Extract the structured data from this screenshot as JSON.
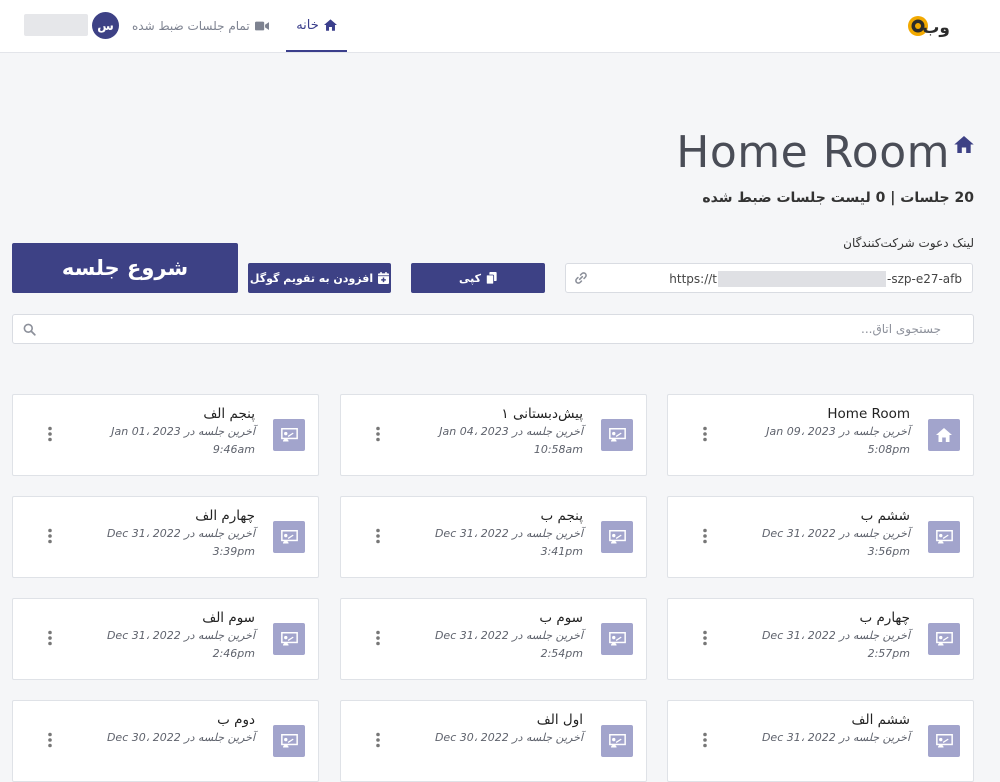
{
  "header": {
    "logo_text": "وب",
    "nav_home": "خانه",
    "nav_recordings": "تمام جلسات ضبط شده",
    "avatar_initial": "س",
    "user_name": ""
  },
  "room": {
    "title": "Home Room",
    "summary": "20 جلسات | 0 لیست جلسات ضبط شده",
    "invite_label": "لینک دعوت شرکت‌کنندگان",
    "invite_url_prefix": "https://t",
    "invite_url_suffix": "-szp-e27-afb",
    "copy_label": "کپی",
    "calendar_label": "افزودن به تقویم گوگل",
    "start_label": "شروع جلسه",
    "search_placeholder": "جستجوی اتاق..."
  },
  "cards": [
    {
      "name": "Home Room",
      "meta": "آخرین جلسه در Jan 09، 2023",
      "time": "5:08pm",
      "icon": "home-icon"
    },
    {
      "name": "پیش‌دبستانی ۱",
      "meta": "آخرین جلسه در Jan 04، 2023",
      "time": "10:58am",
      "icon": "presentation-icon"
    },
    {
      "name": "پنجم الف",
      "meta": "آخرین جلسه در Jan 01، 2023",
      "time": "9:46am",
      "icon": "presentation-icon"
    },
    {
      "name": "ششم ب",
      "meta": "آخرین جلسه در Dec 31، 2022",
      "time": "3:56pm",
      "icon": "presentation-icon"
    },
    {
      "name": "پنجم ب",
      "meta": "آخرین جلسه در Dec 31، 2022",
      "time": "3:41pm",
      "icon": "presentation-icon"
    },
    {
      "name": "چهارم الف",
      "meta": "آخرین جلسه در Dec 31، 2022",
      "time": "3:39pm",
      "icon": "presentation-icon"
    },
    {
      "name": "چهارم ب",
      "meta": "آخرین جلسه در Dec 31، 2022",
      "time": "2:57pm",
      "icon": "presentation-icon"
    },
    {
      "name": "سوم ب",
      "meta": "آخرین جلسه در Dec 31، 2022",
      "time": "2:54pm",
      "icon": "presentation-icon"
    },
    {
      "name": "سوم الف",
      "meta": "آخرین جلسه در Dec 31، 2022",
      "time": "2:46pm",
      "icon": "presentation-icon"
    },
    {
      "name": "ششم الف",
      "meta": "آخرین جلسه در Dec 31، 2022",
      "time": "",
      "icon": "presentation-icon"
    },
    {
      "name": "اول الف",
      "meta": "آخرین جلسه در Dec 30، 2022",
      "time": "",
      "icon": "presentation-icon"
    },
    {
      "name": "دوم ب",
      "meta": "آخرین جلسه در Dec 30، 2022",
      "time": "",
      "icon": "presentation-icon"
    }
  ],
  "colors": {
    "primary": "#3d4185",
    "card_icon_bg": "#a2a4cc",
    "page_bg": "#f5f6f8"
  }
}
